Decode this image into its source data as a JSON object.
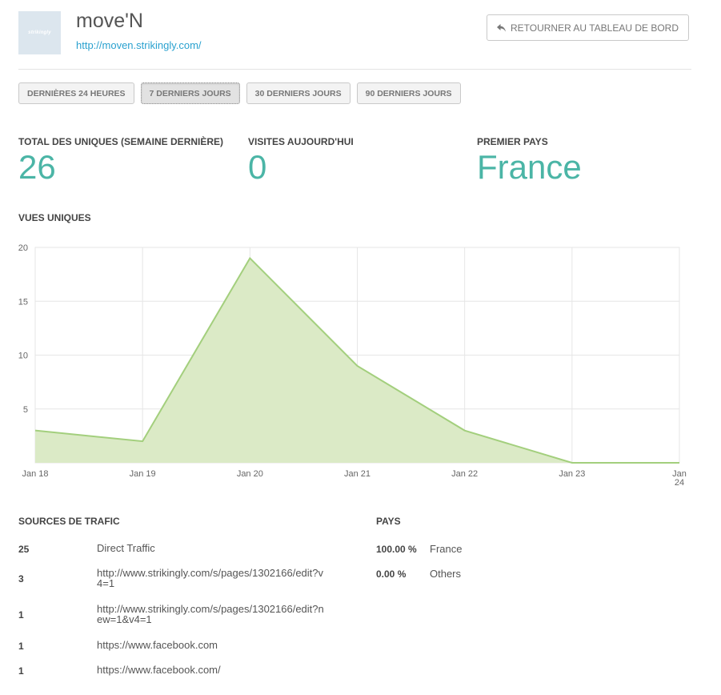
{
  "site": {
    "logo_text": "strikingly",
    "title": "move'N",
    "url": "http://moven.strikingly.com/"
  },
  "header": {
    "back_label": "RETOURNER AU TABLEAU DE BORD"
  },
  "ranges": [
    {
      "label": "DERNIÈRES 24 HEURES",
      "active": false
    },
    {
      "label": "7 DERNIERS JOURS",
      "active": true
    },
    {
      "label": "30 DERNIERS JOURS",
      "active": false
    },
    {
      "label": "90 DERNIERS JOURS",
      "active": false
    }
  ],
  "stats": {
    "total": {
      "label": "TOTAL DES UNIQUES (SEMAINE DERNIÈRE)",
      "value": "26"
    },
    "today": {
      "label": "VISITES AUJOURD'HUI",
      "value": "0"
    },
    "country": {
      "label": "PREMIER PAYS",
      "value": "France"
    }
  },
  "chart_label": "VUES UNIQUES",
  "chart_data": {
    "type": "area",
    "title": "",
    "xlabel": "",
    "ylabel": "",
    "categories": [
      "Jan 18",
      "Jan 19",
      "Jan 20",
      "Jan 21",
      "Jan 22",
      "Jan 23",
      "Jan 24"
    ],
    "series": [
      {
        "values": [
          3,
          2,
          19,
          9,
          3,
          0,
          0
        ]
      }
    ],
    "ylim": [
      0,
      20
    ],
    "yticks": [
      5,
      10,
      15,
      20
    ],
    "grid": true,
    "colors": {
      "fill": "#dbeac6",
      "line": "#a3cf7d",
      "grid": "#e6e6e6"
    }
  },
  "traffic": {
    "title": "SOURCES DE TRAFIC",
    "rows": [
      {
        "count": "25",
        "source": "Direct Traffic"
      },
      {
        "count": "3",
        "source": "http://www.strikingly.com/s/pages/1302166/edit?v4=1"
      },
      {
        "count": "1",
        "source": "http://www.strikingly.com/s/pages/1302166/edit?new=1&v4=1"
      },
      {
        "count": "1",
        "source": "https://www.facebook.com"
      },
      {
        "count": "1",
        "source": "https://www.facebook.com/"
      }
    ]
  },
  "countries": {
    "title": "PAYS",
    "rows": [
      {
        "pct": "100.00 %",
        "name": "France"
      },
      {
        "pct": "0.00 %",
        "name": "Others"
      }
    ]
  },
  "colors": {
    "accent": "#4bb5a6",
    "link": "#2aa1cf"
  }
}
